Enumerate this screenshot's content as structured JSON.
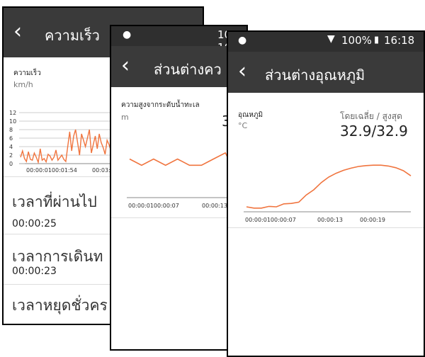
{
  "colors": {
    "accent": "#f0743e",
    "appbar": "#3a3a3a",
    "statusbar": "#2f2f2f"
  },
  "status": {
    "battery": "100%",
    "time": "16:18",
    "partial_time": "100% 16:17"
  },
  "speed_screen": {
    "title": "ความเร็ว",
    "metric_label": "ความเร็ว",
    "unit": "km/h",
    "y_ticks": [
      "12",
      "10",
      "8",
      "6",
      "4",
      "2",
      "0"
    ],
    "x_ticks": [
      "00:00:0100:01:54",
      "00:03:"
    ],
    "rows": [
      {
        "label": "เวลาที่ผ่านไป",
        "value": "00:00:25"
      },
      {
        "label": "เวลาการเดินท",
        "value": "00:00:23"
      },
      {
        "label": "เวลาหยุดชั่วคร",
        "value": ""
      }
    ]
  },
  "altitude_screen": {
    "title": "ส่วนต่างคว",
    "metric_label": "ความสูงจากระดับน้ำทะเล",
    "unit": "m",
    "value_partial": "3",
    "x_ticks": [
      "00:00:0100:00:07",
      "00:00:13"
    ]
  },
  "temperature_screen": {
    "title": "ส่วนต่างอุณหภูมิ",
    "metric_label": "อุณหภูมิ",
    "unit": "°C",
    "avg_label": "โดยเฉลี่ย / สูงสุด",
    "value": "32.9/32.9",
    "x_ticks": [
      "00:00:0100:00:07",
      "00:00:13",
      "00:00:19"
    ]
  },
  "chart_data": [
    {
      "type": "line",
      "series": [
        {
          "values": [
            1.5,
            3.0,
            1.2,
            0.5,
            2.8,
            1.0,
            0.8,
            2.5,
            1.5,
            0.3,
            3.5,
            0.8,
            1.2,
            0.4,
            2.2,
            1.8,
            0.8,
            1.5,
            3.2,
            0.8,
            1.4,
            2.0,
            1.0,
            0.5,
            4.0,
            7.5,
            3.0,
            6.5,
            8.0,
            5.0,
            2.0,
            7.0,
            5.5,
            4.0,
            6.0,
            8.0,
            2.5,
            4.5,
            6.5,
            3.5,
            7.0,
            5.0,
            3.8,
            2.2,
            5.5,
            4.5,
            3.0,
            5.8,
            3.2,
            4.0,
            1.8,
            5.5,
            2.5,
            4.2,
            5.0,
            3.5,
            2.0,
            5.5,
            6.0,
            4.5,
            6.5,
            2.0,
            4.0,
            8.0,
            5.5,
            6.0,
            7.5,
            4.8,
            3.0,
            8.0,
            6.0,
            4.0,
            8.5,
            3.2,
            5.5,
            7.0,
            4.0,
            3.0,
            6.5,
            3.5,
            6.0,
            7.5,
            4.0,
            9.0,
            7.0,
            4.8,
            8.5,
            6.0,
            3.0,
            7.5,
            5.5,
            9.5,
            6.5,
            4.5,
            7.0
          ]
        }
      ],
      "ylim": [
        0,
        12
      ]
    },
    {
      "type": "line",
      "series": [
        {
          "values": [
            6,
            5,
            6,
            5,
            6,
            5,
            5,
            6,
            7,
            3,
            5
          ]
        }
      ]
    },
    {
      "type": "line",
      "series": [
        {
          "values": [
            0.5,
            0.2,
            0.2,
            0.6,
            0.5,
            1.2,
            1.3,
            1.6,
            3.3,
            4.5,
            6.2,
            7.5,
            8.4,
            9.1,
            9.6,
            10.0,
            10.2,
            10.3,
            10.3,
            10.1,
            9.7,
            9.0,
            7.8
          ]
        }
      ]
    }
  ]
}
